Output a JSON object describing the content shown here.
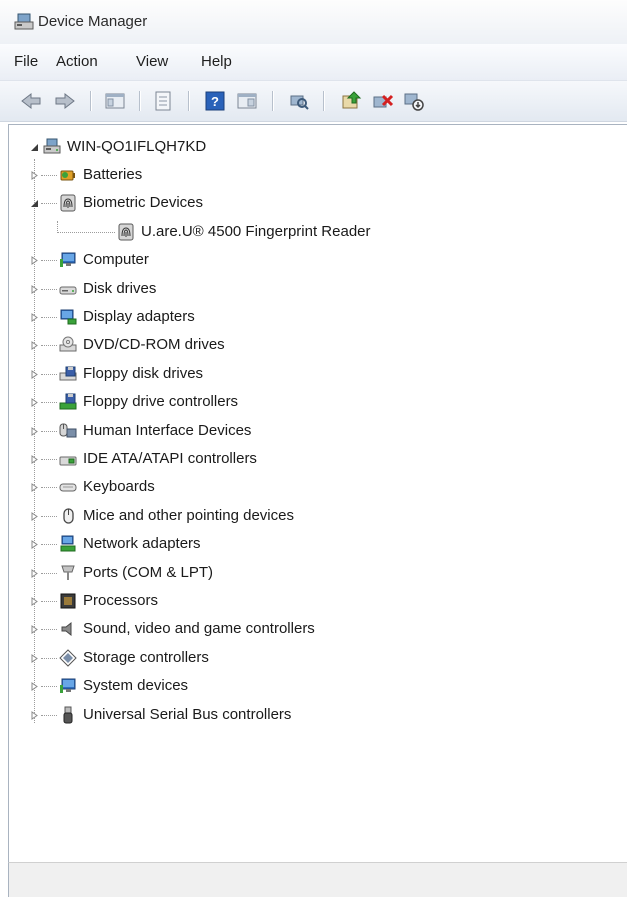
{
  "window": {
    "title": "Device Manager"
  },
  "menu": [
    "File",
    "Action",
    "View",
    "Help"
  ],
  "toolbar": {
    "buttons": [
      "back-arrow-icon",
      "forward-arrow-icon",
      "show-hide-tree-icon",
      "properties-icon",
      "help-icon",
      "console-icon",
      "scan-hardware-icon",
      "update-driver-icon",
      "uninstall-icon",
      "disable-icon"
    ]
  },
  "tree": {
    "root": "WIN-QO1IFLQH7KD",
    "categories": [
      {
        "label": "Batteries",
        "icon": "battery-icon",
        "expanded": false
      },
      {
        "label": "Biometric Devices",
        "icon": "fingerprint-icon",
        "expanded": true
      },
      {
        "label": "U.are.U® 4500 Fingerprint Reader",
        "icon": "fingerprint-icon",
        "child": true
      },
      {
        "label": "Computer",
        "icon": "computer-icon",
        "expanded": false
      },
      {
        "label": "Disk drives",
        "icon": "disk-drive-icon",
        "expanded": false
      },
      {
        "label": "Display adapters",
        "icon": "display-adapter-icon",
        "expanded": false
      },
      {
        "label": "DVD/CD-ROM drives",
        "icon": "dvd-drive-icon",
        "expanded": false
      },
      {
        "label": "Floppy disk drives",
        "icon": "floppy-drive-icon",
        "expanded": false
      },
      {
        "label": "Floppy drive controllers",
        "icon": "floppy-controller-icon",
        "expanded": false
      },
      {
        "label": "Human Interface Devices",
        "icon": "hid-icon",
        "expanded": false
      },
      {
        "label": "IDE ATA/ATAPI controllers",
        "icon": "ide-controller-icon",
        "expanded": false
      },
      {
        "label": "Keyboards",
        "icon": "keyboard-icon",
        "expanded": false
      },
      {
        "label": "Mice and other pointing devices",
        "icon": "mouse-icon",
        "expanded": false
      },
      {
        "label": "Network adapters",
        "icon": "network-adapter-icon",
        "expanded": false
      },
      {
        "label": "Ports (COM & LPT)",
        "icon": "port-icon",
        "expanded": false
      },
      {
        "label": "Processors",
        "icon": "processor-icon",
        "expanded": false
      },
      {
        "label": "Sound, video and game controllers",
        "icon": "sound-icon",
        "expanded": false
      },
      {
        "label": "Storage controllers",
        "icon": "storage-controller-icon",
        "expanded": false
      },
      {
        "label": "System devices",
        "icon": "system-devices-icon",
        "expanded": false
      },
      {
        "label": "Universal Serial Bus controllers",
        "icon": "usb-icon",
        "expanded": false
      }
    ]
  },
  "status": {
    "text": ""
  }
}
